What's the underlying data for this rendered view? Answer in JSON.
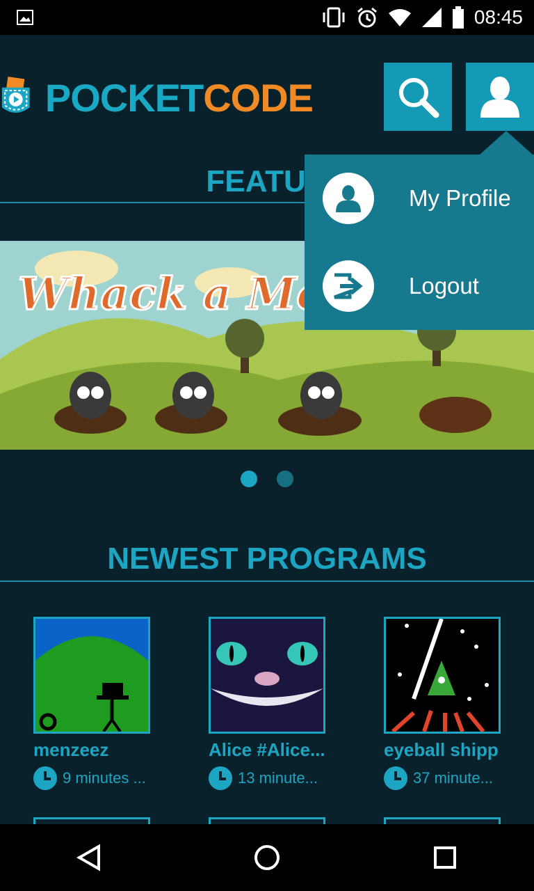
{
  "status_bar": {
    "time": "08:45"
  },
  "app": {
    "logo_part1": "POCKET",
    "logo_part2": "CODE"
  },
  "sections": {
    "featured": "FEATUR",
    "newest": "NEWEST PROGRAMS"
  },
  "banner": {
    "title": "Whack a Mole"
  },
  "menu": {
    "items": [
      {
        "label": "My Profile"
      },
      {
        "label": "Logout"
      }
    ]
  },
  "programs": [
    {
      "name": "menzeez",
      "time": "9 minutes ..."
    },
    {
      "name": "Alice #Alice...",
      "time": "13 minute..."
    },
    {
      "name": "eyeball shipp",
      "time": "37 minute..."
    }
  ],
  "colors": {
    "accent": "#1ca6c3",
    "logo_orange": "#f08a24",
    "menu_bg": "#17798e"
  }
}
